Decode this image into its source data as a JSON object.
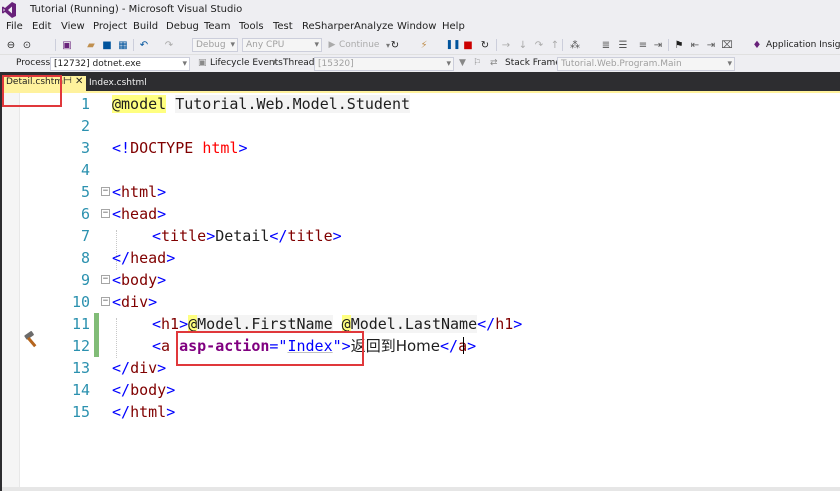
{
  "window": {
    "title": "Tutorial (Running) - Microsoft Visual Studio"
  },
  "menu": [
    "File",
    "Edit",
    "View",
    "Project",
    "Build",
    "Debug",
    "Team",
    "Tools",
    "Test",
    "ReSharper",
    "Analyze",
    "Window",
    "Help"
  ],
  "toolbar": {
    "config": "Debug",
    "platform": "Any CPU",
    "continue_label": "Continue",
    "app_insights": "Application Insights"
  },
  "debugbar": {
    "process_label": "Process:",
    "process_value": "[12732] dotnet.exe",
    "lifecycle_label": "Lifecycle Events",
    "thread_label": "Thread:",
    "thread_value": "[15320]",
    "stackframe_label": "Stack Frame:",
    "stackframe_value": "Tutorial.Web.Program.Main"
  },
  "tabs": [
    {
      "label": "Detail.cshtml",
      "active": true
    },
    {
      "label": "Index.cshtml",
      "active": false
    }
  ],
  "editor": {
    "line_numbers": [
      "1",
      "2",
      "3",
      "4",
      "5",
      "6",
      "7",
      "8",
      "9",
      "10",
      "11",
      "12",
      "13",
      "14",
      "15"
    ],
    "l1": {
      "directive": "@model",
      "type": "Tutorial.Web.Model.Student"
    },
    "l3": {
      "open": "<!",
      "name": "DOCTYPE",
      "attr": "html",
      "close": ">"
    },
    "l5": {
      "name": "html"
    },
    "l6": {
      "name": "head"
    },
    "l7": {
      "name": "title",
      "text": "Detail"
    },
    "l8": {
      "name": "head"
    },
    "l9": {
      "name": "body"
    },
    "l10": {
      "name": "div"
    },
    "l11": {
      "name": "h1",
      "first_at": "@",
      "first": "Model.FirstName",
      "last_at": "@",
      "last": "Model.LastName"
    },
    "l12": {
      "name": "a",
      "attr": "asp-action",
      "value": "Index",
      "text": "返回到Home"
    },
    "l13": {
      "name": "div"
    },
    "l14": {
      "name": "body"
    },
    "l15": {
      "name": "html"
    }
  }
}
